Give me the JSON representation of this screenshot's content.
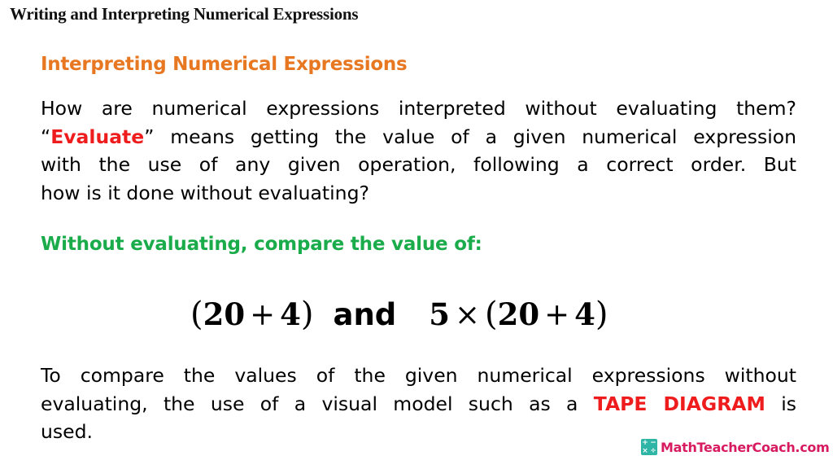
{
  "slide": {
    "title": "Writing and Interpreting Numerical Expressions",
    "section_heading": "Interpreting Numerical Expressions",
    "paragraph_1": {
      "line_1": "How are numerical expressions interpreted without evaluating them?",
      "line_2_open_quote": "“",
      "line_2_highlight": "Evaluate",
      "line_2_rest": "” means getting the value of a given numerical expression",
      "line_3": "with the use of any given operation, following a correct order. But",
      "line_4": "how is it done without evaluating?"
    },
    "prompt_heading": "Without evaluating, compare the value of:",
    "expressions": {
      "first": {
        "open": "(",
        "a": "20",
        "op": "+",
        "b": "4",
        "close": ")"
      },
      "conjunction": "and",
      "second": {
        "factor": "5",
        "times": "×",
        "open": "(",
        "a": "20",
        "op": "+",
        "b": "4",
        "close": ")"
      }
    },
    "paragraph_2": {
      "line_1": "To compare the values of the given numerical expressions without",
      "line_2_start": "evaluating, the use of a visual model such as a ",
      "line_2_highlight": "TAPE DIAGRAM",
      "line_2_end": " is",
      "line_3": "used."
    },
    "colors": {
      "section_heading": "#e87722",
      "highlight_red": "#ee1c1c",
      "prompt_green": "#1aab4b",
      "brand_pink": "#d81b60",
      "brand_teal": "#2fb5a6"
    }
  },
  "brand": {
    "logo_glyphs": [
      "+",
      "−",
      "×",
      "÷"
    ],
    "text": "MathTeacherCoach.com"
  }
}
